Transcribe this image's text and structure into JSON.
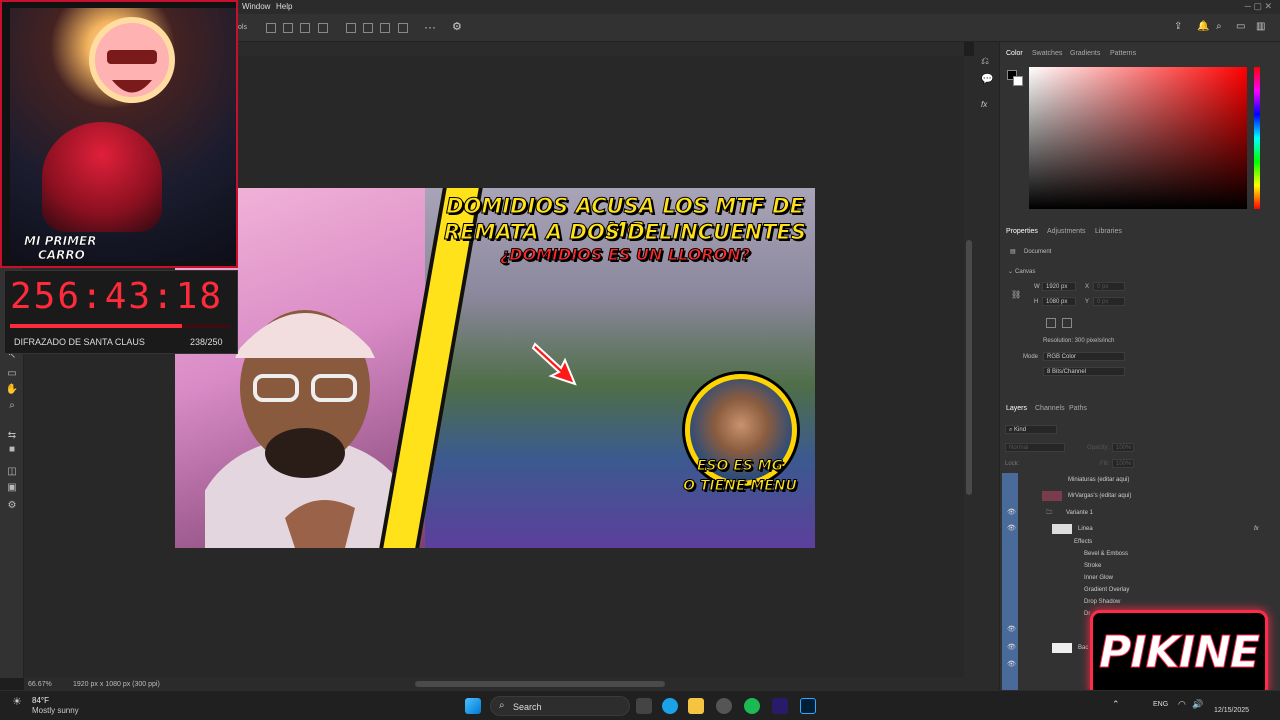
{
  "menubar": {
    "window": "Window",
    "help": "Help",
    "partial_left": "ols"
  },
  "status": {
    "zoom": "66.67%",
    "doc_info": "1920 px x 1080 px (300 ppi)"
  },
  "thumbnail": {
    "line1": "DOMIDIOS ACUSA LOS MTF DE MG",
    "line2": "REMATA A DOS DELINCUENTES",
    "line3": "¿DOMIDIOS ES UN LLORON?",
    "bubble1": "ESO ES MG",
    "bubble2": "O TIENE MENU"
  },
  "color_panel": {
    "tabs": [
      "Color",
      "Swatches",
      "Gradients",
      "Patterns"
    ]
  },
  "properties_panel": {
    "tabs": [
      "Properties",
      "Adjustments",
      "Libraries"
    ],
    "doc_label": "Document",
    "canvas_label": "Canvas",
    "w_label": "W",
    "w_value": "1920 px",
    "h_label": "H",
    "h_value": "1080 px",
    "x_label": "X",
    "y_label": "Y",
    "x_value": "0 px",
    "y_value": "0 px",
    "resolution": "Resolution: 300 pixels/inch",
    "mode_label": "Mode",
    "mode_value": "RGB Color",
    "bits_value": "8 Bits/Channel"
  },
  "layers_panel": {
    "tabs": [
      "Layers",
      "Channels",
      "Paths"
    ],
    "kind": "Kind",
    "blend": "Normal",
    "opacity_label": "Opacity:",
    "opacity_value": "100%",
    "lock_label": "Lock:",
    "fill_label": "Fill:",
    "fill_value": "100%",
    "rows": [
      {
        "name": "Miniaturas (editar aqui)"
      },
      {
        "name": "MrVargas's (editar aqui)"
      },
      {
        "name": "Variante 1"
      },
      {
        "name": "Linea"
      },
      {
        "name": "Effects"
      },
      {
        "name": "Bevel & Emboss"
      },
      {
        "name": "Stroke"
      },
      {
        "name": "Inner Glow"
      },
      {
        "name": "Gradient Overlay"
      },
      {
        "name": "Drop Shadow"
      },
      {
        "name": "Dr"
      },
      {
        "name": "Bac"
      }
    ]
  },
  "overlay": {
    "badge_line1": "MI PRIMER",
    "badge_line2": "CARRO",
    "timer": "256:43:18",
    "progress_label": "DIFRAZADO DE SANTA CLAUS",
    "progress_count": "238/250",
    "progress_fraction": 0.78,
    "brand": "PIKINE"
  },
  "taskbar": {
    "weather_temp": "84°F",
    "weather_desc": "Mostly sunny",
    "search": "Search",
    "lang": "ENG",
    "date": "12/15/2025"
  },
  "colors": {
    "accent": "#ff2b3a",
    "highlight": "#ffe21a",
    "layer_vis": "#4a6a9a"
  }
}
